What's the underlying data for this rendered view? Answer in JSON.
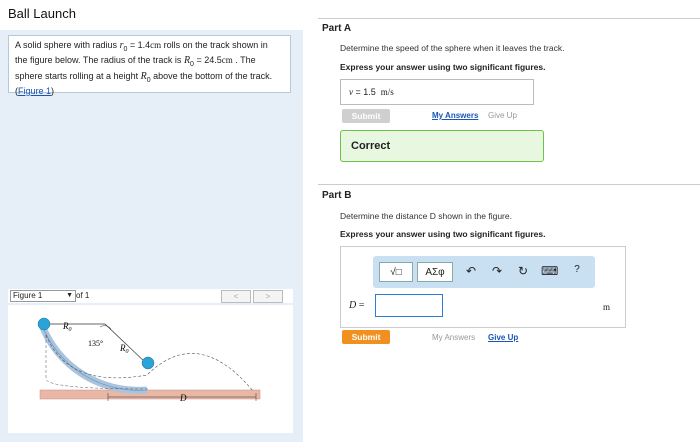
{
  "header": {
    "title": "Ball Launch"
  },
  "problem": {
    "line1_a": "A solid sphere with radius ",
    "r_sym": "r",
    "r_sub": "0",
    "line1_b": " = 1.4",
    "line1_unit": "cm",
    "line1_c": " rolls on the track shown in",
    "line2": "the figure below.  The radius of the track is ",
    "R_sym": "R",
    "R_sub": "0",
    "line2_b": " = 24.5",
    "line2_unit": "cm",
    "line2_c": " . The",
    "line3_a": "sphere starts rolling at a height ",
    "line3_b": " above the bottom of the track.",
    "figure_link": "Figure 1"
  },
  "figure_nav": {
    "selected": "Figure 1",
    "of_text": "of 1",
    "prev": "<",
    "next": ">"
  },
  "figure": {
    "label_R0_top": "R",
    "label_R0_mid": "R",
    "sub0": "0",
    "angle": "135°",
    "label_D": "D"
  },
  "partA": {
    "heading": "Part A",
    "prompt": "Determine the speed of the sphere when it leaves the track.",
    "instruction": "Express your answer using two significant figures.",
    "answer_var": "v",
    "answer_eq": " =  ",
    "answer_value": "1.5",
    "answer_unit": "m/s",
    "submit_label": "Submit",
    "my_answers": "My Answers",
    "give_up": "Give Up",
    "feedback": "Correct"
  },
  "partB": {
    "heading": "Part B",
    "prompt": "Determine the distance D shown in the figure.",
    "instruction": "Express your answer using two significant figures.",
    "toolbar": {
      "templates": "√□",
      "symbols": "ΑΣφ",
      "undo": "↶",
      "redo": "↷",
      "reset": "↻",
      "keyboard": "⌨",
      "help": "?"
    },
    "var_label": "D",
    "eq": " =",
    "input_value": "",
    "unit": "m",
    "submit_label": "Submit",
    "my_answers": "My Answers",
    "give_up": "Give Up"
  },
  "colors": {
    "submit_active": "#f0901e",
    "submit_disabled": "#cfcfcf",
    "link_blue": "#1a55b5",
    "correct_bg": "#e8f8e0",
    "correct_border": "#6cc24a",
    "ball": "#2aa3d8",
    "track": "#a9c4de",
    "floor": "#e8b7a6"
  }
}
